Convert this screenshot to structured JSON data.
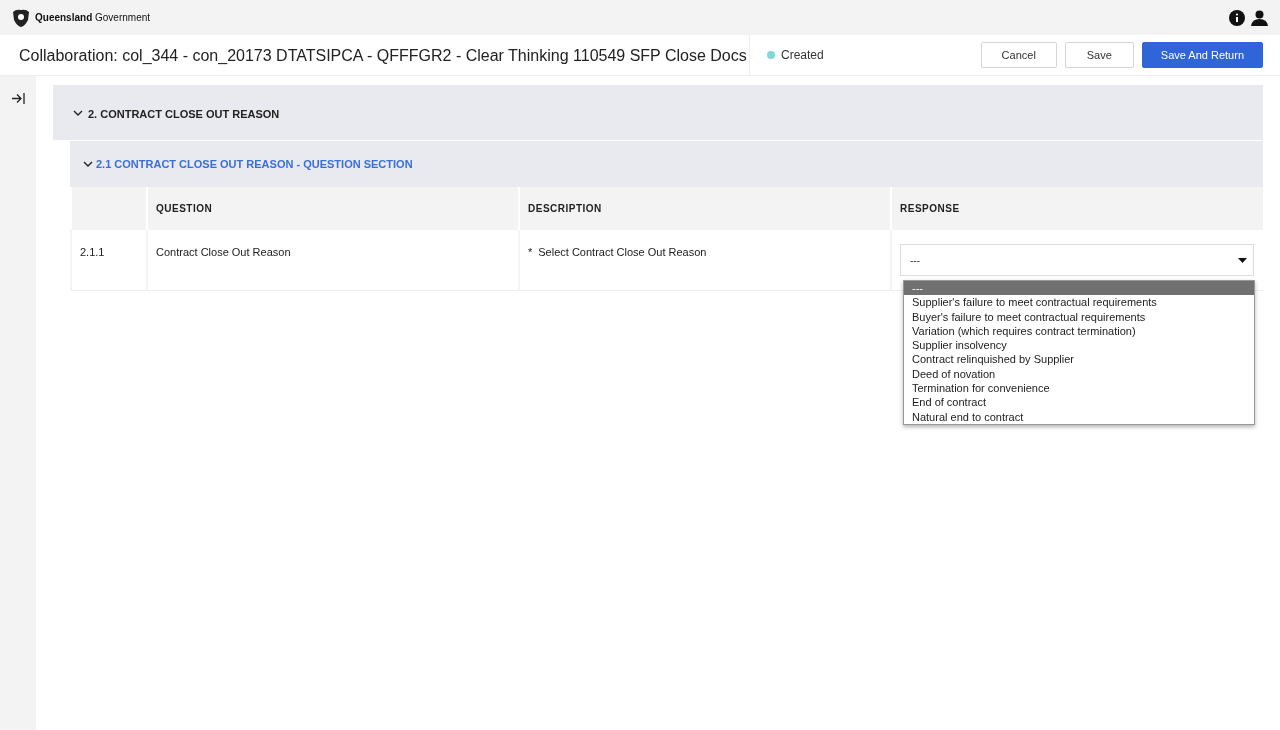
{
  "brand": {
    "text": "**Queensland** Government"
  },
  "header": {
    "title": "Collaboration: col_344 - con_20173 DTATSIPCA - QFFFGR2 - Clear Thinking 110549 SFP Close Docs",
    "status": "Created",
    "buttons": [
      {
        "label": "Cancel",
        "kind": "secondary"
      },
      {
        "label": "Save",
        "kind": "secondary"
      },
      {
        "label": "Save And Return",
        "kind": "primary"
      }
    ]
  },
  "section": {
    "title": "2. CONTRACT CLOSE OUT REASON",
    "expanded": true,
    "subsection": {
      "title": "2.1 CONTRACT CLOSE OUT REASON - QUESTION SECTION",
      "expanded": true,
      "table": {
        "columns": [
          "QUESTION",
          "DESCRIPTION",
          "RESPONSE"
        ],
        "rows": [
          {
            "number": "2.1.1",
            "question": "Contract Close Out Reason",
            "required": true,
            "required_mark": "*",
            "description": "Select Contract Close Out Reason",
            "response": {
              "value": "---",
              "expanded": true,
              "options": [
                {
                  "label": "---",
                  "selected": true
                },
                {
                  "label": "Supplier's failure to meet contractual requirements",
                  "selected": false
                },
                {
                  "label": "Buyer's failure to meet contractual requirements",
                  "selected": false
                },
                {
                  "label": "Variation (which requires contract termination)",
                  "selected": false
                },
                {
                  "label": "Supplier insolvency",
                  "selected": false
                },
                {
                  "label": "Contract relinquished by Supplier",
                  "selected": false
                },
                {
                  "label": "Deed of novation",
                  "selected": false
                },
                {
                  "label": "Termination for convenience",
                  "selected": false
                },
                {
                  "label": "End of contract",
                  "selected": false
                },
                {
                  "label": "Natural end to contract",
                  "selected": false
                }
              ]
            }
          }
        ]
      }
    }
  }
}
